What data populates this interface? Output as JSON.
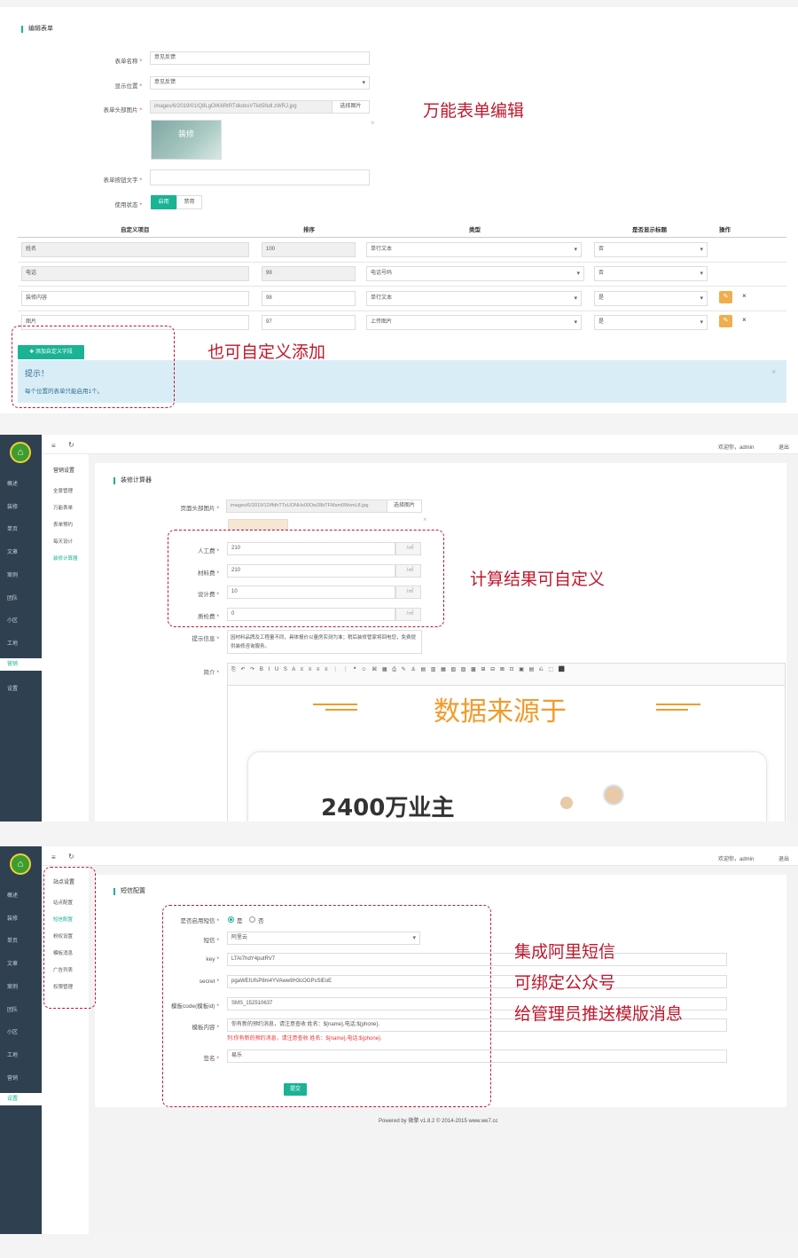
{
  "panel1": {
    "section_title": "编辑表单",
    "labels": {
      "name": "表单名称",
      "position": "显示位置",
      "header_image": "表单头部图片",
      "button_text": "表单按钮文字",
      "status": "使用状态"
    },
    "name_value": "意见反馈",
    "position_value": "意见反馈",
    "image_path": "images/6/2019/01/Q8LgOIK6RtRTdkoksVTkit5Ndl.zWRJ.jpg",
    "choose_image_label": "选择图片",
    "thumbnail_text": "装修",
    "status_enable": "启用",
    "status_disable": "禁用",
    "table_headers": [
      "自定义项目",
      "排序",
      "类型",
      "是否显示标题",
      "操作"
    ],
    "rows": [
      {
        "name": "姓名",
        "sort": "100",
        "type": "单行文本",
        "show": "否"
      },
      {
        "name": "电话",
        "sort": "99",
        "type": "电话号码",
        "show": "否"
      },
      {
        "name": "装修内容",
        "sort": "98",
        "type": "单行文本",
        "show": "是"
      },
      {
        "name": "图片",
        "sort": "97",
        "type": "上传图片",
        "show": "是"
      }
    ],
    "add_button": "✚ 添加自定义字段",
    "alert_title": "提示！",
    "alert_body": "每个位置的表单只能启用1个。",
    "annotation_main": "万能表单编辑",
    "annotation_add": "也可自定义添加"
  },
  "panel2": {
    "welcome": "欢迎你，admin",
    "logout": "退出",
    "sidebar": [
      "概述",
      "装修",
      "单页",
      "文章",
      "案例",
      "团队",
      "小区",
      "工地",
      "营销",
      "设置"
    ],
    "submenu_title": "营销设置",
    "submenu": [
      "全景管理",
      "万能表单",
      "表单预约",
      "每天设计",
      "装修计算器"
    ],
    "section_title": "装修计算器",
    "labels": {
      "page_image": "页面头部图片",
      "labor": "人工费",
      "material": "材料费",
      "design": "设计费",
      "quality": "质检费",
      "tip": "提示信息",
      "intro": "简介"
    },
    "image_path": "images/6/2019/12/ffdhTTxUONHs00Ow28bTFMsm0WsmL8.jpg",
    "choose_image_label": "选择图片",
    "labor_value": "210",
    "material_value": "210",
    "design_value": "10",
    "quality_value": "0",
    "unit": "/㎡",
    "tip_value": "因材料品牌及工程量不同，具体报价以量房实测为准；稍后装修管家将回电您，免费提供装修咨询服务。",
    "editor_heading": "数据来源于",
    "editor_subtext": "2400万业主",
    "annotation": "计算结果可自定义"
  },
  "panel3": {
    "welcome": "欢迎你，admin",
    "logout": "退出",
    "sidebar": [
      "概述",
      "装修",
      "单页",
      "文章",
      "案例",
      "团队",
      "小区",
      "工地",
      "营销",
      "设置"
    ],
    "submenu_title": "站点设置",
    "submenu": [
      "站点配置",
      "短信配置",
      "粉权设置",
      "模板消息",
      "广告列表",
      "权限管理"
    ],
    "section_title": "短信配置",
    "labels": {
      "enable": "是否启用短信",
      "sms": "短信",
      "key": "key",
      "secret": "secret",
      "template_code": "模板code(模板id)",
      "template_content": "模板内容",
      "signature": "签名"
    },
    "enable_yes": "是",
    "enable_no": "否",
    "sms_value": "阿里云",
    "key_value": "LTAI7hdY4putRV7",
    "secret_value": "pgaWEIUfsP8m4YVAww9H3cOGPsSlEoE",
    "template_code_value": "SMS_152510637",
    "template_content_value": "你有新的预约消息，请注意查收 姓名：${name},电话:${phone}.",
    "template_hint": "列:你有新的预约消息，请注意查收 姓名：${name},电话:${phone}.",
    "signature_value": "易乐",
    "submit": "提交",
    "footer": "Powered by 微擎 v1.8.2 © 2014-2015 www.we7.cc",
    "annotations": [
      "集成阿里短信",
      "可绑定公众号",
      "给管理员推送模版消息"
    ]
  },
  "colors": {
    "accent": "#1ab394",
    "sidebar": "#2f4050",
    "annotation": "#c0182d",
    "alert_bg": "#d9edf7",
    "orange": "#f0ad4e"
  }
}
